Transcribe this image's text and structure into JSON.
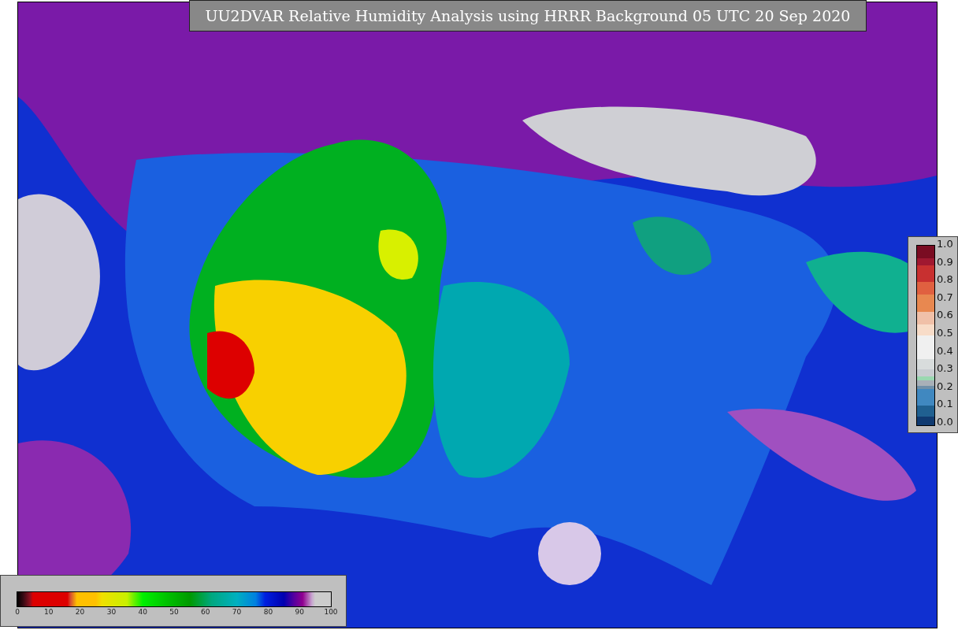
{
  "title": "UU2DVAR Relative Humidity Analysis using HRRR Background 05 UTC 20 Sep 2020",
  "humidity_scale": {
    "ticks": [
      "0",
      "10",
      "20",
      "30",
      "40",
      "50",
      "60",
      "70",
      "80",
      "90",
      "100"
    ]
  },
  "observation_scale": {
    "ticks": [
      "1.0",
      "0.9",
      "0.8",
      "0.7",
      "0.6",
      "0.5",
      "0.4",
      "0.3",
      "0.2",
      "0.1",
      "0.0"
    ]
  }
}
